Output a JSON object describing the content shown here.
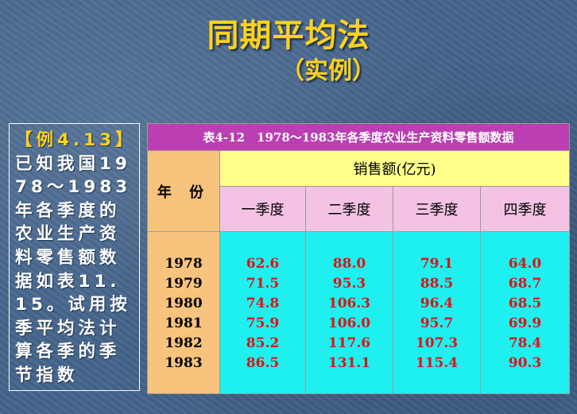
{
  "title": "同期平均法",
  "subtitle": "（实例）",
  "example": {
    "label": "【例4.13】",
    "text": "已知我国1978～1983年各季度的农业生产资料零售额数据如表11.15。试用按季平均法计算各季的季节指数"
  },
  "table": {
    "caption": "表4-12　1978～1983年各季度农业生产资料零售额数据",
    "year_header": "年 份",
    "group_header": "销售额(亿元)",
    "quarters": [
      "一季度",
      "二季度",
      "三季度",
      "四季度"
    ],
    "years": [
      "1978",
      "1979",
      "1980",
      "1981",
      "1982",
      "1983"
    ],
    "q1": [
      "62.6",
      "71.5",
      "74.8",
      "75.9",
      "85.2",
      "86.5"
    ],
    "q2": [
      "88.0",
      "95.3",
      "106.3",
      "106.0",
      "117.6",
      "131.1"
    ],
    "q3": [
      "79.1",
      "88.5",
      "96.4",
      "95.7",
      "107.3",
      "115.4"
    ],
    "q4": [
      "64.0",
      "68.7",
      "68.5",
      "69.9",
      "78.4",
      "90.3"
    ]
  }
}
